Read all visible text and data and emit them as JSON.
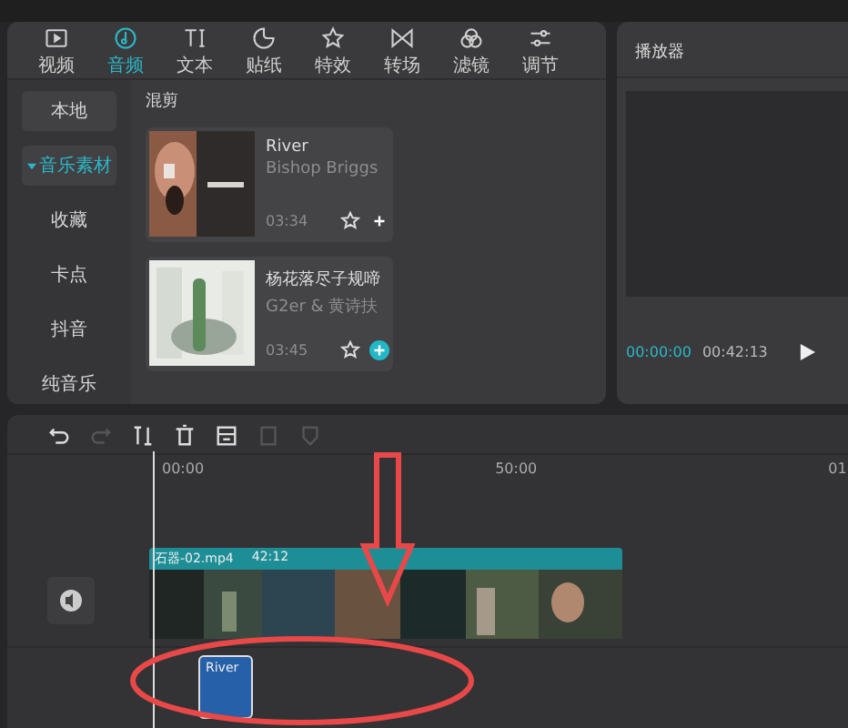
{
  "tabs": [
    {
      "label": "视频",
      "selected": false
    },
    {
      "label": "音频",
      "selected": true
    },
    {
      "label": "文本",
      "selected": false
    },
    {
      "label": "贴纸",
      "selected": false
    },
    {
      "label": "特效",
      "selected": false
    },
    {
      "label": "转场",
      "selected": false
    },
    {
      "label": "滤镜",
      "selected": false
    },
    {
      "label": "调节",
      "selected": false
    }
  ],
  "sidebar": {
    "items": [
      {
        "label": "本地",
        "selected": false,
        "boxed": true,
        "expandable": false
      },
      {
        "label": "音乐素材",
        "selected": true,
        "boxed": true,
        "expandable": true
      },
      {
        "label": "收藏",
        "selected": false,
        "boxed": false,
        "expandable": false
      },
      {
        "label": "卡点",
        "selected": false,
        "boxed": false,
        "expandable": false
      },
      {
        "label": "抖音",
        "selected": false,
        "boxed": false,
        "expandable": false
      },
      {
        "label": "纯音乐",
        "selected": false,
        "boxed": false,
        "expandable": false
      }
    ]
  },
  "library": {
    "heading": "混剪",
    "tracks": [
      {
        "title": "River",
        "artist": "Bishop Briggs",
        "duration": "03:34",
        "highlighted": false
      },
      {
        "title": "杨花落尽子规啼",
        "artist": "G2er & 黄诗扶",
        "duration": "03:45",
        "highlighted": true
      }
    ]
  },
  "player": {
    "title": "播放器",
    "current_time": "00:00:00",
    "total_time": "00:42:13"
  },
  "timeline": {
    "tools": [
      {
        "disabled": false
      },
      {
        "disabled": true
      },
      {
        "disabled": false
      },
      {
        "disabled": false
      },
      {
        "disabled": false
      },
      {
        "disabled": true
      },
      {
        "disabled": true
      }
    ],
    "ruler": [
      "00:00",
      "50:00",
      "01"
    ],
    "video_clip": {
      "name": "石器-02.mp4",
      "duration": "42:12"
    },
    "audio_clip": {
      "title": "River"
    }
  }
}
